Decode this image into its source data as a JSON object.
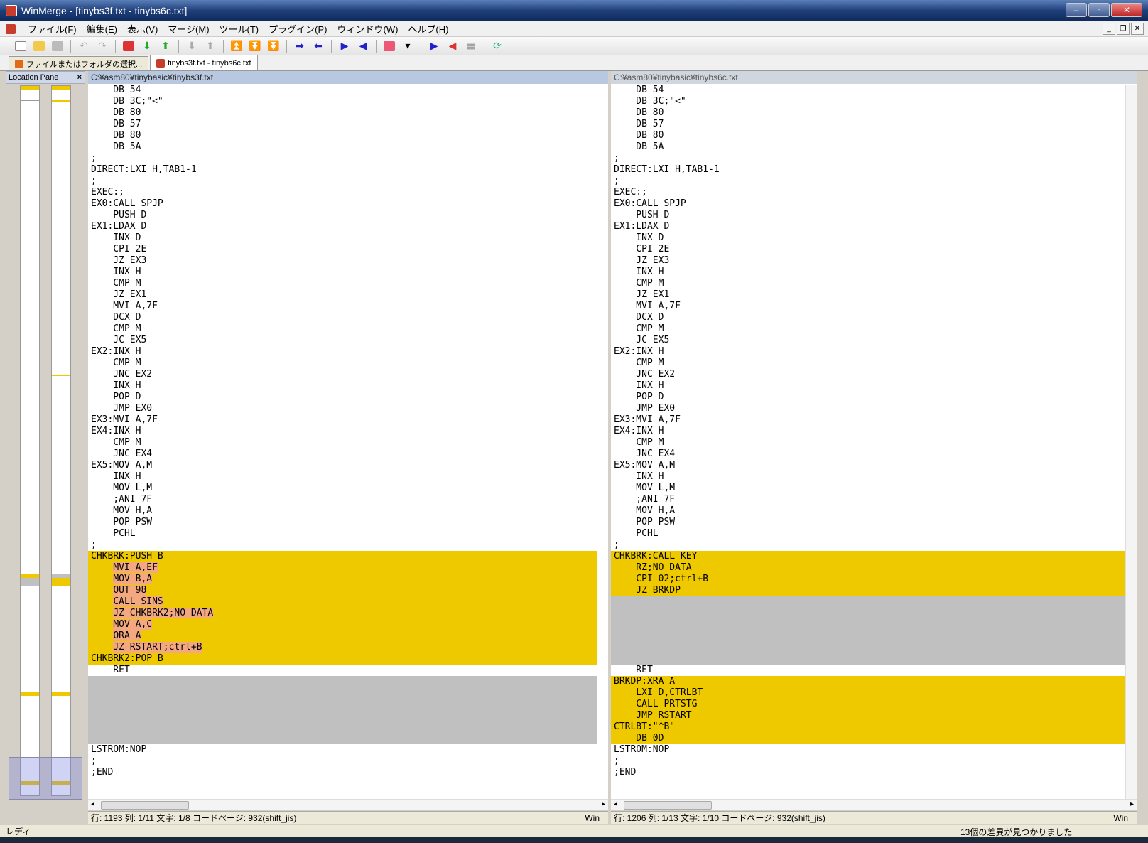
{
  "window": {
    "title": "WinMerge - [tinybs3f.txt - tinybs6c.txt]"
  },
  "menu": [
    "ファイル(F)",
    "編集(E)",
    "表示(V)",
    "マージ(M)",
    "ツール(T)",
    "プラグイン(P)",
    "ウィンドウ(W)",
    "ヘルプ(H)"
  ],
  "tabs": [
    {
      "label": "ファイルまたはフォルダの選択..."
    },
    {
      "label": "tinybs3f.txt - tinybs6c.txt"
    }
  ],
  "location_pane": {
    "title": "Location Pane",
    "close": "×"
  },
  "left": {
    "path": "C:¥asm80¥tinybasic¥tinybs3f.txt",
    "status": "行: 1193  列: 1/11  文字: 1/8  コードページ: 932(shift_jis)",
    "eol": "Win",
    "lines": [
      {
        "t": "    DB 54"
      },
      {
        "t": "    DB 3C;\"<\""
      },
      {
        "t": "    DB 80"
      },
      {
        "t": "    DB 57"
      },
      {
        "t": "    DB 80"
      },
      {
        "t": "    DB 5A"
      },
      {
        "t": ";"
      },
      {
        "t": "DIRECT:LXI H,TAB1-1"
      },
      {
        "t": ";"
      },
      {
        "t": "EXEC:;"
      },
      {
        "t": "EX0:CALL SPJP"
      },
      {
        "t": "    PUSH D"
      },
      {
        "t": "EX1:LDAX D"
      },
      {
        "t": "    INX D"
      },
      {
        "t": "    CPI 2E"
      },
      {
        "t": "    JZ EX3"
      },
      {
        "t": "    INX H"
      },
      {
        "t": "    CMP M"
      },
      {
        "t": "    JZ EX1"
      },
      {
        "t": "    MVI A,7F"
      },
      {
        "t": "    DCX D"
      },
      {
        "t": "    CMP M"
      },
      {
        "t": "    JC EX5"
      },
      {
        "t": "EX2:INX H"
      },
      {
        "t": "    CMP M"
      },
      {
        "t": "    JNC EX2"
      },
      {
        "t": "    INX H"
      },
      {
        "t": "    POP D"
      },
      {
        "t": "    JMP EX0"
      },
      {
        "t": "EX3:MVI A,7F"
      },
      {
        "t": "EX4:INX H"
      },
      {
        "t": "    CMP M"
      },
      {
        "t": "    JNC EX4"
      },
      {
        "t": "EX5:MOV A,M"
      },
      {
        "t": "    INX H"
      },
      {
        "t": "    MOV L,M"
      },
      {
        "t": "    ;ANI 7F"
      },
      {
        "t": "    MOV H,A"
      },
      {
        "t": "    POP PSW"
      },
      {
        "t": "    PCHL"
      },
      {
        "t": ";"
      },
      {
        "t": "CHKBRK:PUSH B",
        "k": "diff"
      },
      {
        "t": "    MVI A,EF",
        "k": "diff",
        "h": true
      },
      {
        "t": "    MOV B,A",
        "k": "diff",
        "h": true
      },
      {
        "t": "    OUT 98",
        "k": "diff",
        "h": true
      },
      {
        "t": "    CALL SINS",
        "k": "diff",
        "h": true
      },
      {
        "t": "    JZ CHKBRK2;NO DATA",
        "k": "diff",
        "h": true
      },
      {
        "t": "    MOV A,C",
        "k": "diff",
        "h": true
      },
      {
        "t": "    ORA A",
        "k": "diff",
        "h": true
      },
      {
        "t": "    JZ RSTART;ctrl+B",
        "k": "diff",
        "h": true
      },
      {
        "t": "CHKBRK2:POP B",
        "k": "diff"
      },
      {
        "t": "    RET"
      },
      {
        "t": "",
        "k": "gap"
      },
      {
        "t": "",
        "k": "gap"
      },
      {
        "t": "",
        "k": "gap"
      },
      {
        "t": "",
        "k": "gap"
      },
      {
        "t": "",
        "k": "gap"
      },
      {
        "t": "",
        "k": "gap"
      },
      {
        "t": "LSTROM:NOP"
      },
      {
        "t": ";"
      },
      {
        "t": ";END"
      }
    ]
  },
  "right": {
    "path": "C:¥asm80¥tinybasic¥tinybs6c.txt",
    "status": "行: 1206  列: 1/13  文字: 1/10  コードページ: 932(shift_jis)",
    "eol": "Win",
    "lines": [
      {
        "t": "    DB 54"
      },
      {
        "t": "    DB 3C;\"<\""
      },
      {
        "t": "    DB 80"
      },
      {
        "t": "    DB 57"
      },
      {
        "t": "    DB 80"
      },
      {
        "t": "    DB 5A"
      },
      {
        "t": ";"
      },
      {
        "t": "DIRECT:LXI H,TAB1-1"
      },
      {
        "t": ";"
      },
      {
        "t": "EXEC:;"
      },
      {
        "t": "EX0:CALL SPJP"
      },
      {
        "t": "    PUSH D"
      },
      {
        "t": "EX1:LDAX D"
      },
      {
        "t": "    INX D"
      },
      {
        "t": "    CPI 2E"
      },
      {
        "t": "    JZ EX3"
      },
      {
        "t": "    INX H"
      },
      {
        "t": "    CMP M"
      },
      {
        "t": "    JZ EX1"
      },
      {
        "t": "    MVI A,7F"
      },
      {
        "t": "    DCX D"
      },
      {
        "t": "    CMP M"
      },
      {
        "t": "    JC EX5"
      },
      {
        "t": "EX2:INX H"
      },
      {
        "t": "    CMP M"
      },
      {
        "t": "    JNC EX2"
      },
      {
        "t": "    INX H"
      },
      {
        "t": "    POP D"
      },
      {
        "t": "    JMP EX0"
      },
      {
        "t": "EX3:MVI A,7F"
      },
      {
        "t": "EX4:INX H"
      },
      {
        "t": "    CMP M"
      },
      {
        "t": "    JNC EX4"
      },
      {
        "t": "EX5:MOV A,M"
      },
      {
        "t": "    INX H"
      },
      {
        "t": "    MOV L,M"
      },
      {
        "t": "    ;ANI 7F"
      },
      {
        "t": "    MOV H,A"
      },
      {
        "t": "    POP PSW"
      },
      {
        "t": "    PCHL"
      },
      {
        "t": ";"
      },
      {
        "t": "CHKBRK:CALL KEY",
        "k": "diff"
      },
      {
        "t": "    RZ;NO DATA",
        "k": "diff"
      },
      {
        "t": "    CPI 02;ctrl+B",
        "k": "diff"
      },
      {
        "t": "    JZ BRKDP",
        "k": "diff"
      },
      {
        "t": "",
        "k": "gap"
      },
      {
        "t": "",
        "k": "gap"
      },
      {
        "t": "",
        "k": "gap"
      },
      {
        "t": "",
        "k": "gap"
      },
      {
        "t": "",
        "k": "gap"
      },
      {
        "t": "",
        "k": "gap"
      },
      {
        "t": "    RET"
      },
      {
        "t": "BRKDP:XRA A",
        "k": "diff"
      },
      {
        "t": "    LXI D,CTRLBT",
        "k": "diff"
      },
      {
        "t": "    CALL PRTSTG",
        "k": "diff"
      },
      {
        "t": "    JMP RSTART",
        "k": "diff"
      },
      {
        "t": "CTRLBT:\"^B\"",
        "k": "diff"
      },
      {
        "t": "    DB 0D",
        "k": "diff"
      },
      {
        "t": "LSTROM:NOP"
      },
      {
        "t": ";"
      },
      {
        "t": ";END"
      }
    ]
  },
  "statusbar": {
    "ready": "レディ",
    "found": "13個の差異が見つかりました"
  },
  "colors": {
    "diff": "#efc900",
    "gap": "#c0c0c0",
    "wordDiff": "#f4a880"
  }
}
